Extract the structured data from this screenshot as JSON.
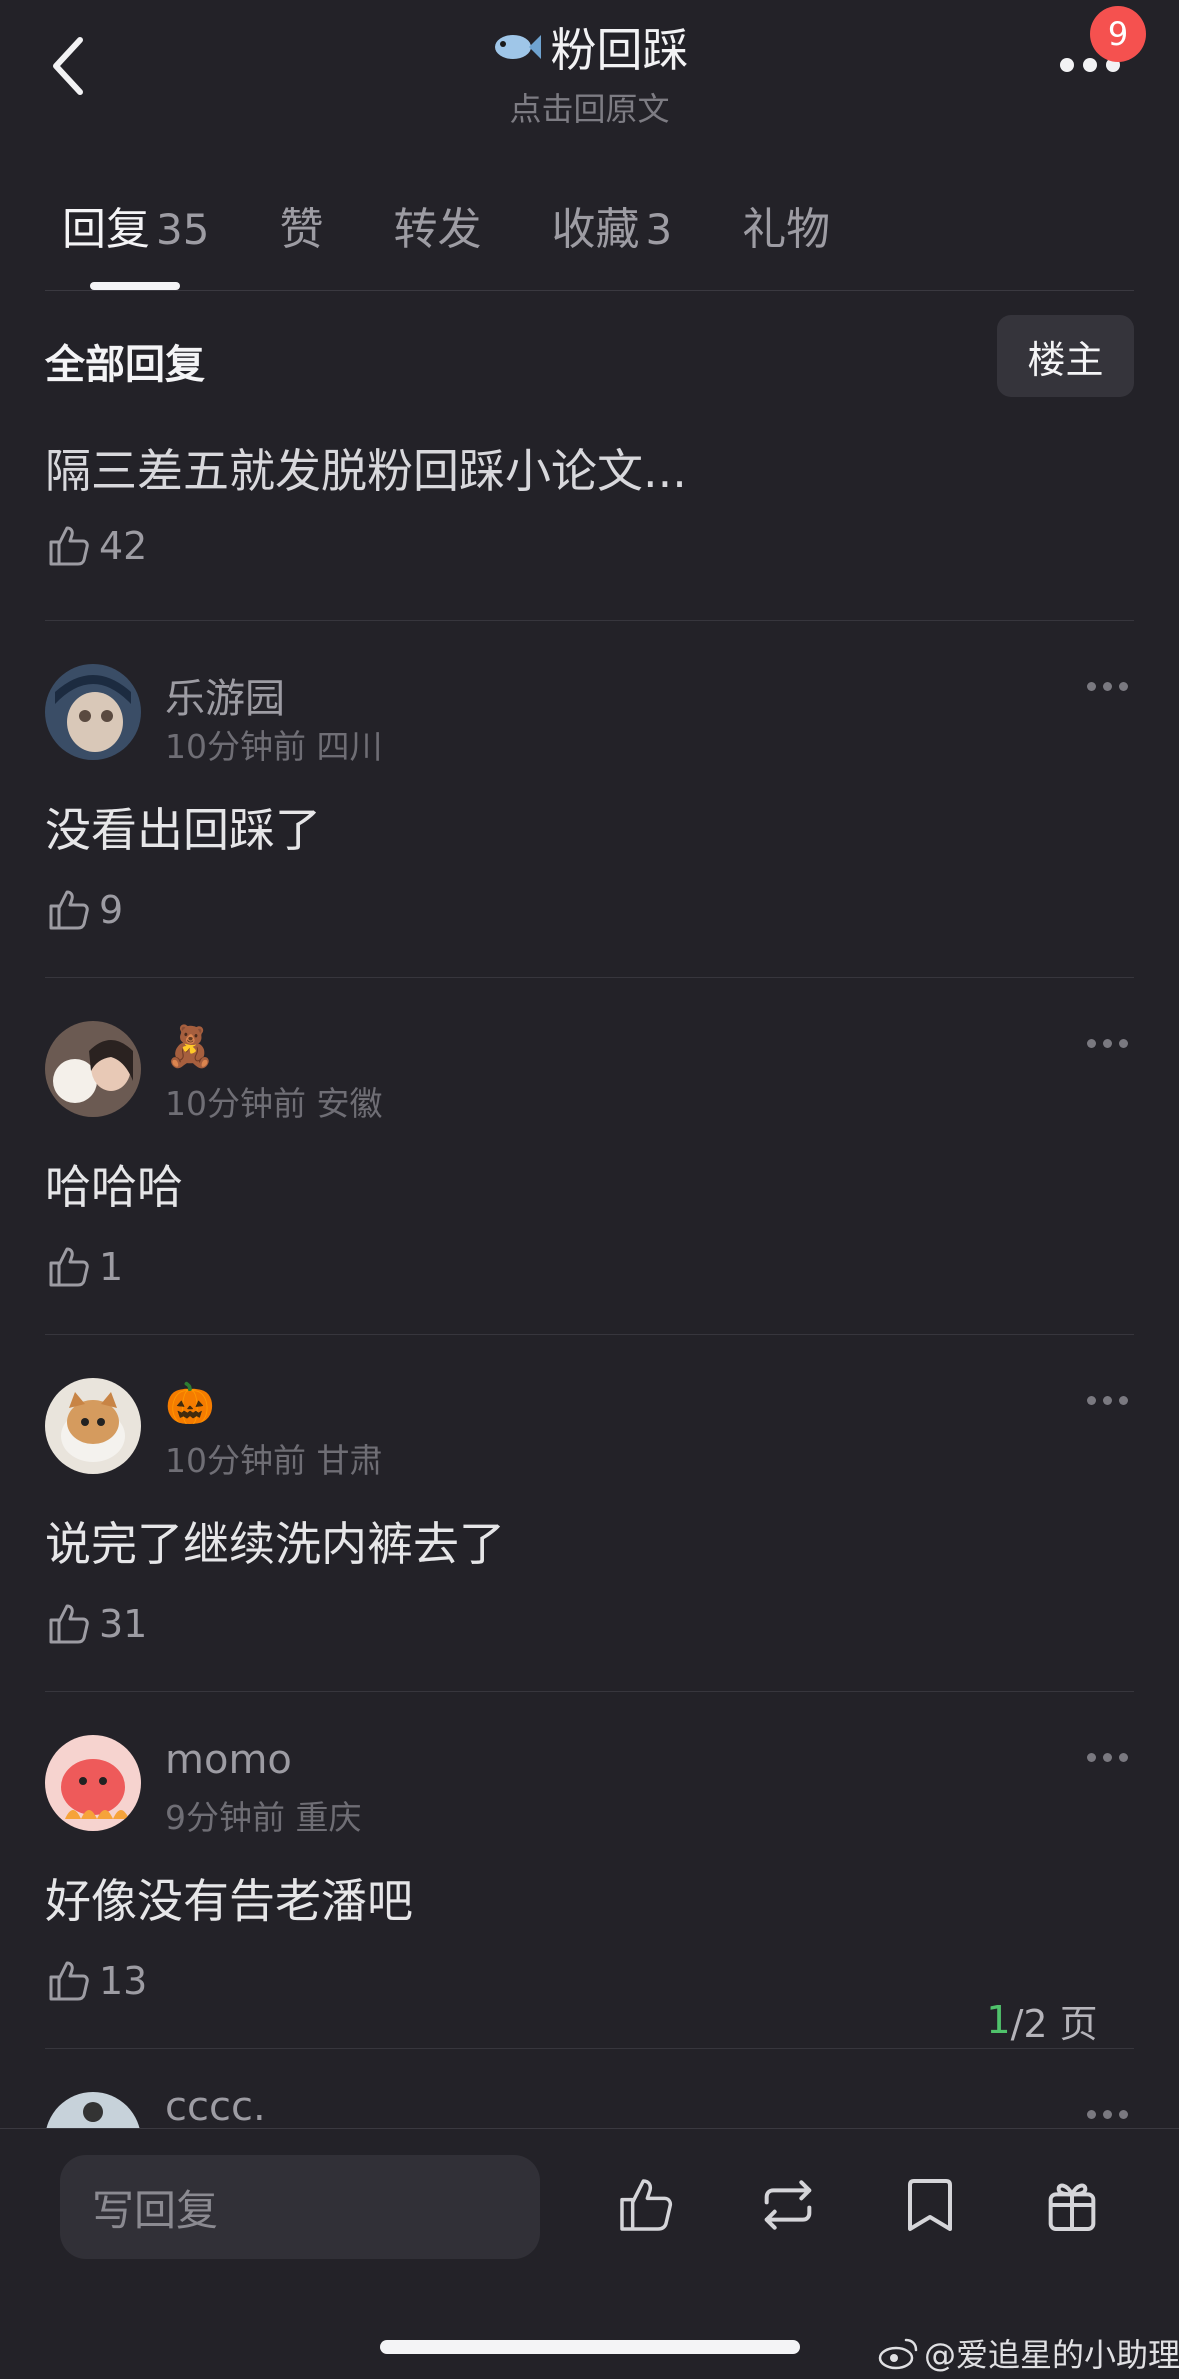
{
  "header": {
    "title": "粉回踩",
    "subtitle": "点击回原文",
    "notification_count": "9"
  },
  "tabs": [
    {
      "label": "回复",
      "count": "35",
      "active": true
    },
    {
      "label": "赞",
      "count": ""
    },
    {
      "label": "转发",
      "count": ""
    },
    {
      "label": "收藏",
      "count": "3"
    },
    {
      "label": "礼物",
      "count": ""
    }
  ],
  "filter": {
    "label": "全部回复",
    "owner_button": "楼主"
  },
  "top_post": {
    "text": "隔三差五就发脱粉回踩小论文...",
    "likes": "42"
  },
  "comments": [
    {
      "username": "乐游园",
      "time": "10分钟前",
      "location": "四川",
      "text": "没看出回踩了",
      "likes": "9",
      "avatar_color": "#4c6f8f"
    },
    {
      "username": "🧸",
      "time": "10分钟前",
      "location": "安徽",
      "text": "哈哈哈",
      "likes": "1",
      "avatar_color": "#a58a80"
    },
    {
      "username": "🎃",
      "time": "10分钟前",
      "location": "甘肃",
      "text": "说完了继续洗内裤去了",
      "likes": "31",
      "avatar_color": "#c9a37a"
    },
    {
      "username": "momo",
      "time": "9分钟前",
      "location": "重庆",
      "text": "好像没有告老潘吧",
      "likes": "13",
      "avatar_color": "#ee6a6a"
    },
    {
      "username": "cccc.",
      "time": "",
      "location": "",
      "text": "",
      "likes": "",
      "avatar_color": "#8a9aa8"
    }
  ],
  "pagination": {
    "current": "1",
    "total": "/2 页"
  },
  "bottom_bar": {
    "reply_placeholder": "写回复",
    "icons": [
      "like-icon",
      "repost-icon",
      "bookmark-icon",
      "gift-icon"
    ]
  },
  "watermark": "@爱追星的小助理"
}
